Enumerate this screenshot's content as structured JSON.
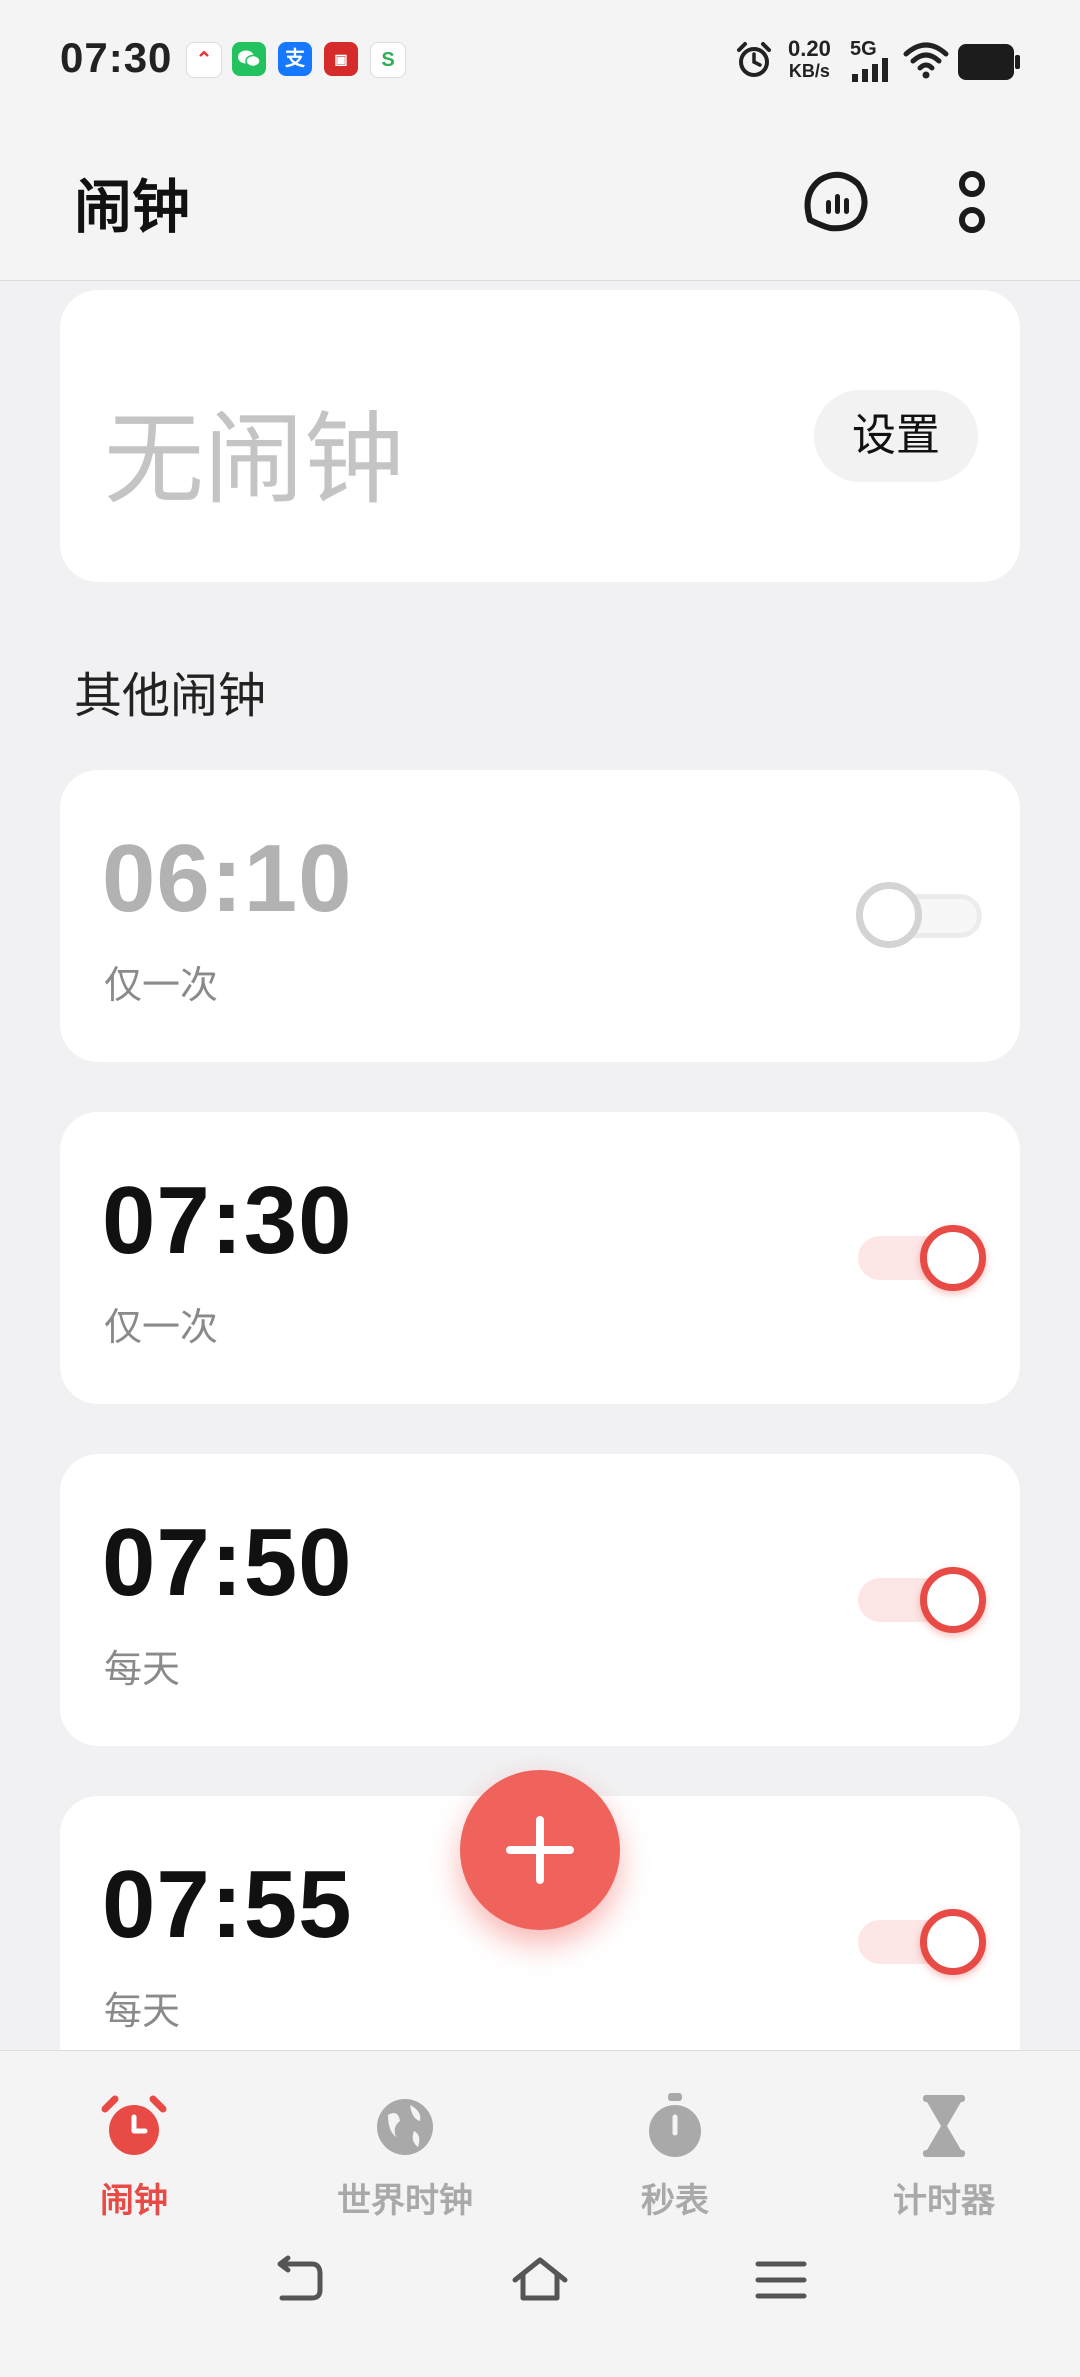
{
  "status_bar": {
    "time": "07:30",
    "speed_value": "0.20",
    "speed_unit": "KB/s",
    "network": "5G",
    "apps": [
      "compass-icon",
      "wechat-icon",
      "alipay-icon",
      "news-app-icon",
      "green-app-icon"
    ]
  },
  "header": {
    "title": "闹钟",
    "icons": [
      "sound-wave-icon",
      "more-vertical-icon"
    ]
  },
  "next_alarm": {
    "label": "无闹钟",
    "button": "设置"
  },
  "section_title": "其他闹钟",
  "alarms": [
    {
      "time": "06:10",
      "repeat": "仅一次",
      "enabled": false
    },
    {
      "time": "07:30",
      "repeat": "仅一次",
      "enabled": true
    },
    {
      "time": "07:50",
      "repeat": "每天",
      "enabled": true
    },
    {
      "time": "07:55",
      "repeat": "每天",
      "enabled": true
    }
  ],
  "tabs": [
    {
      "label": "闹钟",
      "icon": "alarm-clock-icon",
      "active": true
    },
    {
      "label": "世界时钟",
      "icon": "globe-icon",
      "active": false
    },
    {
      "label": "秒表",
      "icon": "stopwatch-icon",
      "active": false
    },
    {
      "label": "计时器",
      "icon": "hourglass-icon",
      "active": false
    }
  ],
  "colors": {
    "accent": "#e84a45",
    "fab": "#f0625c",
    "background": "#f1f1f3",
    "inactive": "#a9a9a9"
  }
}
